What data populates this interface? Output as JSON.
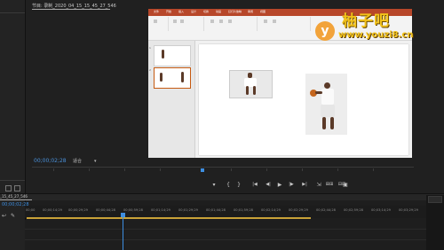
{
  "program_monitor": {
    "tab_title": "节目: 录制_2020_04_15_15_45_27_546",
    "timecode": "00;00;02;28",
    "fit_label": "适合"
  },
  "ppt": {
    "tabs": [
      "文件",
      "开始",
      "插入",
      "设计",
      "切换",
      "动画",
      "幻灯片放映",
      "审阅",
      "视图"
    ],
    "slide_numbers": [
      "1",
      "2"
    ]
  },
  "watermark": {
    "letter": "y",
    "name": "柚子吧",
    "url": "www.youzi8.cn"
  },
  "transport": {
    "buttons": [
      "▾",
      "{",
      "}",
      "|◀",
      "◀|",
      "▶",
      "|▶",
      "▶|",
      "⇲",
      "⊞⊞",
      "⊟⊟",
      "▣"
    ]
  },
  "timeline": {
    "sequence_tab": "_15_45_27_546",
    "timecode": "00;00;02;28",
    "ruler_labels": [
      "00;00",
      "00;00;14;29",
      "00;00;29;29",
      "00;00;44;28",
      "00;00;59;28",
      "00;01;14;29",
      "00;01;29;29",
      "00;01;44;28",
      "00;01;59;28",
      "00;02;14;29",
      "00;02;29;29",
      "00;02;44;28",
      "00;02;59;28",
      "00;03;14;29",
      "00;03;29;29"
    ]
  },
  "colors": {
    "accent": "#3d8ee0",
    "workarea": "#c9a238",
    "ppt_brand": "#b7472a",
    "watermark": "#f3c31b"
  }
}
